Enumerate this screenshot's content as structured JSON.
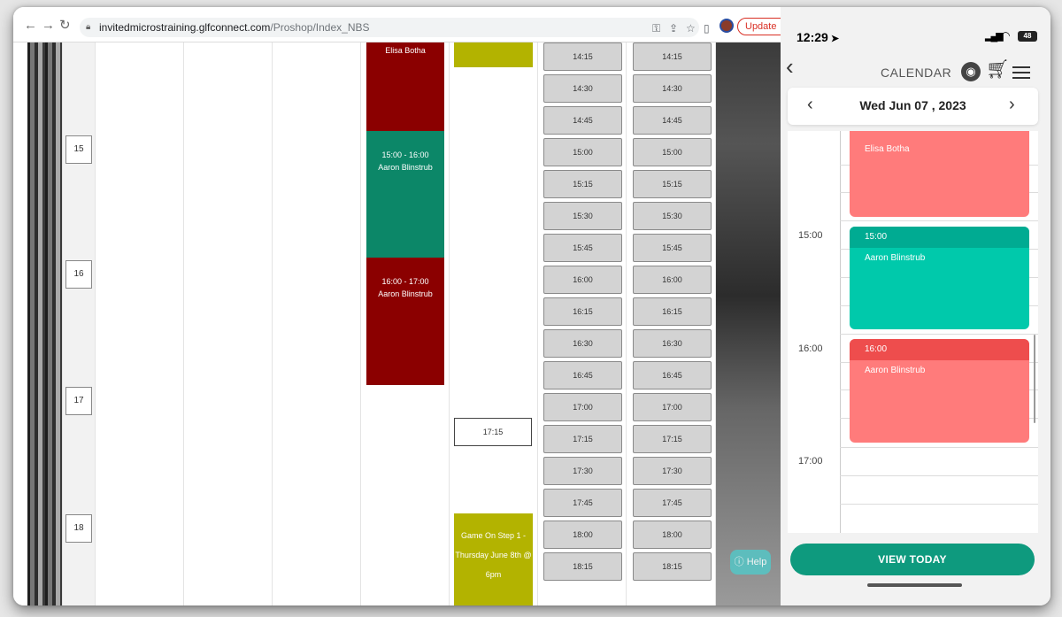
{
  "browser": {
    "url_host": "invitedmicrostraining.glfconnect.com",
    "url_path": "/Proshop/Index_NBS",
    "update_label": "Update",
    "update_dots": "⋮",
    "hours": [
      "15",
      "16",
      "17",
      "18"
    ],
    "events": {
      "elisa_name": "Elisa Botha",
      "aaron1_time": "15:00 - 16:00",
      "aaron1_name": "Aaron Blinstrub",
      "aaron2_time": "16:00 - 17:00",
      "aaron2_name": "Aaron Blinstrub",
      "game_line1": "Game On Step 1 -",
      "game_line2": "Thursday June 8th @",
      "game_line3": "6pm"
    },
    "selected_slot": "17:15",
    "slots": [
      "14:15",
      "14:30",
      "14:45",
      "15:00",
      "15:15",
      "15:30",
      "15:45",
      "16:00",
      "16:15",
      "16:30",
      "16:45",
      "17:00",
      "17:15",
      "17:30",
      "17:45",
      "18:00",
      "18:15"
    ],
    "help_label": "Help",
    "colors": {
      "event_red": "#8b0000",
      "event_green": "#0c8768",
      "event_olive": "#b3b300"
    }
  },
  "phone": {
    "time": "12:29",
    "battery": "48",
    "title": "CALENDAR",
    "date": "Wed Jun 07 , 2023",
    "time_labels": [
      "15:00",
      "16:00",
      "17:00"
    ],
    "events": {
      "elisa_name": "Elisa Botha",
      "aaron1_time": "15:00",
      "aaron1_name": "Aaron Blinstrub",
      "aaron2_time": "16:00",
      "aaron2_name": "Aaron Blinstrub"
    },
    "view_today_label": "VIEW TODAY",
    "colors": {
      "teal": "#00c9ab",
      "red": "#ff7b7b",
      "button": "#0e9a7e"
    }
  }
}
